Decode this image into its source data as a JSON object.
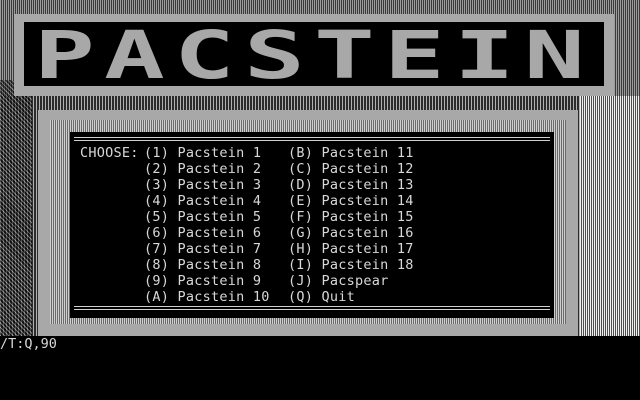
{
  "logo": {
    "title": "PACSTEIN"
  },
  "menu": {
    "prompt": "CHOOSE:",
    "column1": [
      "(1) Pacstein 1",
      "(2) Pacstein 2",
      "(3) Pacstein 3",
      "(4) Pacstein 4",
      "(5) Pacstein 5",
      "(6) Pacstein 6",
      "(7) Pacstein 7",
      "(8) Pacstein 8",
      "(9) Pacstein 9",
      "(A) Pacstein 10"
    ],
    "column2": [
      "(B) Pacstein 11",
      "(C) Pacstein 12",
      "(D) Pacstein 13",
      "(E) Pacstein 14",
      "(F) Pacstein 15",
      "(G) Pacstein 16",
      "(H) Pacstein 17",
      "(I) Pacstein 18",
      "(J) Pacspear",
      "(Q) Quit"
    ]
  },
  "status_line": "/T:Q,90",
  "colors": {
    "background": "#000000",
    "frame": "#a8a8a8",
    "text": "#d8d8d8"
  }
}
